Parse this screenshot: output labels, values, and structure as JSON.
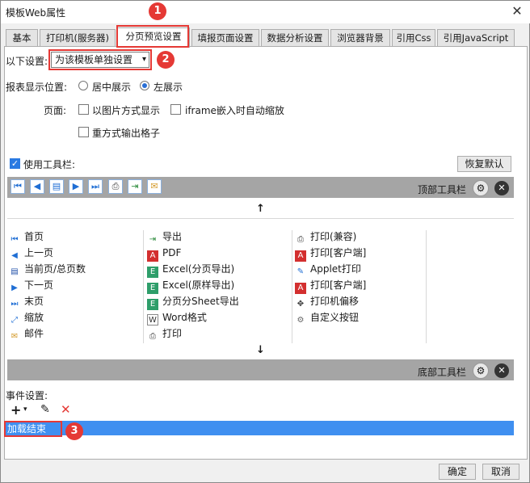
{
  "window": {
    "title": "模板Web属性"
  },
  "tabs": [
    {
      "label": "基本"
    },
    {
      "label": "打印机(服务器)"
    },
    {
      "label": "分页预览设置"
    },
    {
      "label": "填报页面设置"
    },
    {
      "label": "数据分析设置"
    },
    {
      "label": "浏览器背景"
    },
    {
      "label": "引用Css"
    },
    {
      "label": "引用JavaScript"
    }
  ],
  "settings": {
    "scope_label": "以下设置:",
    "scope_value": "为该模板单独设置",
    "position_label": "报表显示位置:",
    "position_options": [
      "居中展示",
      "左展示"
    ],
    "page_label": "页面:",
    "page_options": [
      "以图片方式显示",
      "iframe嵌入时自动缩放",
      "重方式输出格子"
    ],
    "use_toolbar": "使用工具栏:",
    "restore_default": "恢复默认"
  },
  "callouts": {
    "one": "1",
    "two": "2",
    "three": "3"
  },
  "toolbars": {
    "top_label": "顶部工具栏",
    "bottom_label": "底部工具栏",
    "up_arrow": "↑",
    "down_arrow": "↓"
  },
  "toolbar_items": {
    "col1": [
      "首页",
      "上一页",
      "当前页/总页数",
      "下一页",
      "末页",
      "缩放",
      "邮件"
    ],
    "col2": [
      "导出",
      "PDF",
      "Excel(分页导出)",
      "Excel(原样导出)",
      "分页分Sheet导出",
      "Word格式",
      "打印"
    ],
    "col3": [
      "打印(兼容)",
      "打印[客户端]",
      "Applet打印",
      "打印[客户端]",
      "打印机偏移",
      "自定义按钮"
    ]
  },
  "events": {
    "label": "事件设置:",
    "item": "加载结束"
  },
  "footer": {
    "ok": "确定",
    "cancel": "取消"
  },
  "colors": {
    "accent": "#3f8ff0",
    "callout": "#e53935",
    "bar": "#a5a5a5"
  }
}
